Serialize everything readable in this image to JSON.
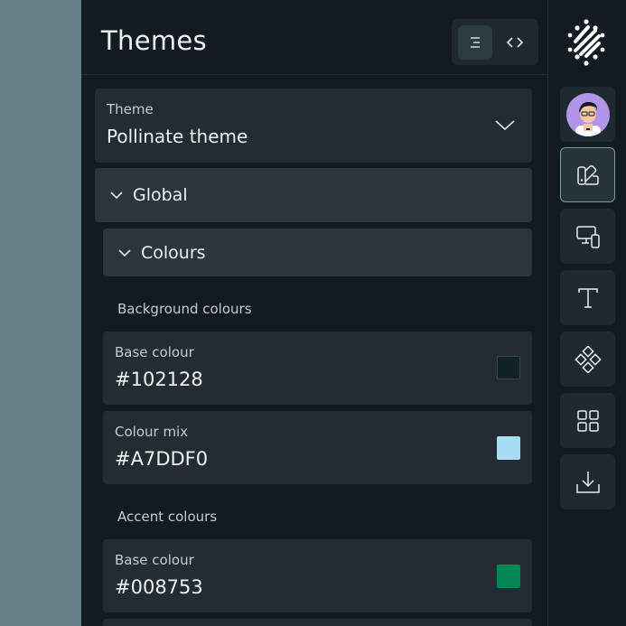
{
  "header": {
    "title": "Themes"
  },
  "view_toggle": {
    "active": "list",
    "items": [
      {
        "name": "list-view",
        "icon": "list-align-right-icon"
      },
      {
        "name": "code-view",
        "icon": "code-brackets-icon"
      }
    ]
  },
  "theme_select": {
    "label": "Theme",
    "value": "Pollinate theme"
  },
  "sections": {
    "global_label": "Global",
    "colours_label": "Colours"
  },
  "background_colours": {
    "heading": "Background colours",
    "items": [
      {
        "label": "Base colour",
        "value": "#102128",
        "swatch": "#102128"
      },
      {
        "label": "Colour mix",
        "value": "#A7DDF0",
        "swatch": "#A7DDF0"
      }
    ]
  },
  "accent_colours": {
    "heading": "Accent colours",
    "items": [
      {
        "label": "Base colour",
        "value": "#008753",
        "swatch": "#008753"
      }
    ]
  },
  "rail": {
    "items": [
      {
        "name": "avatar",
        "icon": "user-avatar"
      },
      {
        "name": "themes",
        "icon": "palette-icon",
        "active": true
      },
      {
        "name": "devices",
        "icon": "devices-icon"
      },
      {
        "name": "typography",
        "icon": "text-icon"
      },
      {
        "name": "components",
        "icon": "components-icon"
      },
      {
        "name": "layouts",
        "icon": "grid-icon"
      },
      {
        "name": "download",
        "icon": "download-icon"
      }
    ]
  }
}
